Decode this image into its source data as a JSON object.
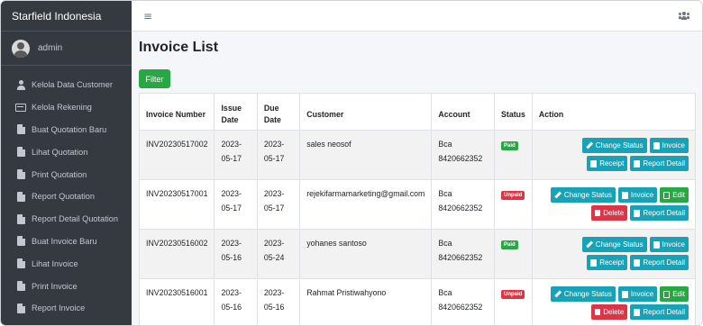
{
  "brand": "Starfield Indonesia",
  "user": {
    "name": "admin"
  },
  "sidebar": {
    "items": [
      {
        "label": "Kelola Data Customer",
        "icon": "user-icon"
      },
      {
        "label": "Kelola Rekening",
        "icon": "credit-card-icon"
      },
      {
        "label": "Buat Quotation Baru",
        "icon": "file-icon"
      },
      {
        "label": "Lihat Quotation",
        "icon": "file-icon"
      },
      {
        "label": "Print Quotation",
        "icon": "file-icon"
      },
      {
        "label": "Report Quotation",
        "icon": "file-icon"
      },
      {
        "label": "Report Detail Quotation",
        "icon": "file-icon"
      },
      {
        "label": "Buat Invoice Baru",
        "icon": "file-icon"
      },
      {
        "label": "Lihat Invoice",
        "icon": "file-icon"
      },
      {
        "label": "Print Invoice",
        "icon": "file-icon"
      },
      {
        "label": "Report Invoice",
        "icon": "file-icon"
      }
    ]
  },
  "topbar": {
    "menu_icon": "≡",
    "users_icon": "users-icon"
  },
  "page": {
    "title": "Invoice List",
    "filter_label": "Filter"
  },
  "table": {
    "headers": {
      "invoice_number": "Invoice Number",
      "issue_date": "Issue Date",
      "due_date": "Due Date",
      "customer": "Customer",
      "account": "Account",
      "status": "Status",
      "action": "Action"
    },
    "rows": [
      {
        "invoice_number": "INV20230517002",
        "issue_date": "2023-05-17",
        "due_date": "2023-05-17",
        "customer": "sales neosof",
        "account": "Bca 8420662352",
        "status": "Paid",
        "buttons": {
          "change_status": "Change Status",
          "invoice": "Invoice",
          "receipt": "Receipt",
          "report_detail": "Report Detail"
        }
      },
      {
        "invoice_number": "INV20230517001",
        "issue_date": "2023-05-17",
        "due_date": "2023-05-17",
        "customer": "rejekifarmamarketing@gmail.com",
        "account": "Bca 8420662352",
        "status": "Unpaid",
        "buttons": {
          "change_status": "Change Status",
          "invoice": "Invoice",
          "edit": "Edit",
          "delete": "Delete",
          "report_detail": "Report Detail"
        }
      },
      {
        "invoice_number": "INV20230516002",
        "issue_date": "2023-05-16",
        "due_date": "2023-05-24",
        "customer": "yohanes santoso",
        "account": "Bca 8420662352",
        "status": "Paid",
        "buttons": {
          "change_status": "Change Status",
          "invoice": "Invoice",
          "receipt": "Receipt",
          "report_detail": "Report Detail"
        }
      },
      {
        "invoice_number": "INV20230516001",
        "issue_date": "2023-05-16",
        "due_date": "2023-05-16",
        "customer": "Rahmat Pristiwahyono",
        "account": "Bca 8420662352",
        "status": "Unpaid",
        "buttons": {
          "change_status": "Change Status",
          "invoice": "Invoice",
          "edit": "Edit",
          "delete": "Delete",
          "report_detail": "Report Detail"
        }
      }
    ]
  },
  "colors": {
    "sidebar_bg": "#343a40",
    "content_bg": "#f4f6f9",
    "primary_success": "#28a745",
    "info": "#17a2b8",
    "danger": "#dc3545"
  }
}
